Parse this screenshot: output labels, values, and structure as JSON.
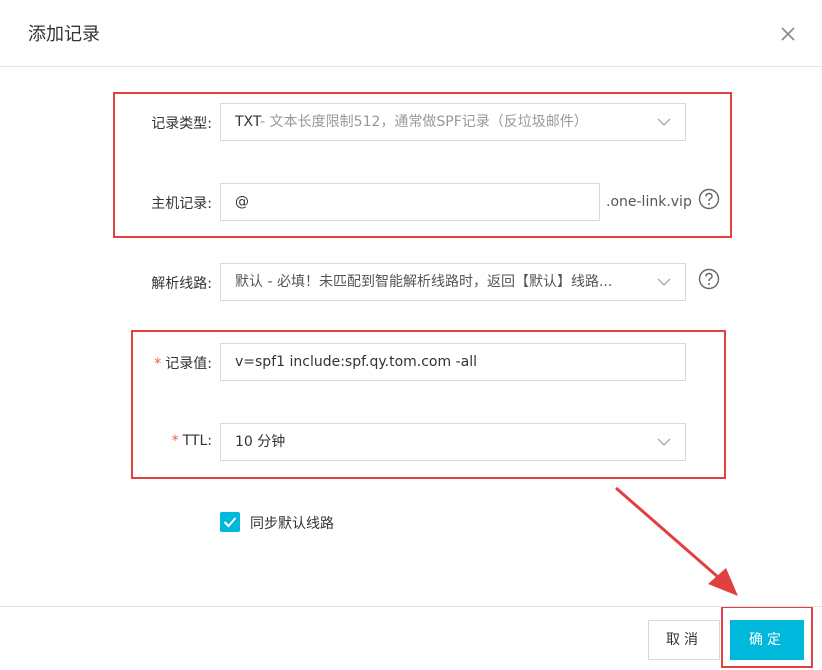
{
  "dialog": {
    "title": "添加记录",
    "close_icon": "close-icon"
  },
  "form": {
    "record_type": {
      "label": "记录类型:",
      "value_main": "TXT",
      "value_sub": "- 文本长度限制512，通常做SPF记录（反垃圾邮件）"
    },
    "host_record": {
      "label": "主机记录:",
      "value": "@",
      "suffix": ".one-link.vip"
    },
    "resolve_line": {
      "label": "解析线路:",
      "value": "默认 - 必填！未匹配到智能解析线路时，返回【默认】线路..."
    },
    "record_value": {
      "required_mark": "*",
      "label": "记录值:",
      "value": "v=spf1 include:spf.qy.tom.com -all"
    },
    "ttl": {
      "required_mark": "*",
      "label": "TTL:",
      "value": "10 分钟"
    },
    "sync_default": {
      "checked": true,
      "label": "同步默认线路"
    }
  },
  "footer": {
    "cancel_label": "取消",
    "ok_label": "确定"
  },
  "colors": {
    "accent": "#00b7dc",
    "annotation": "#e04040",
    "required": "#f05b41"
  }
}
